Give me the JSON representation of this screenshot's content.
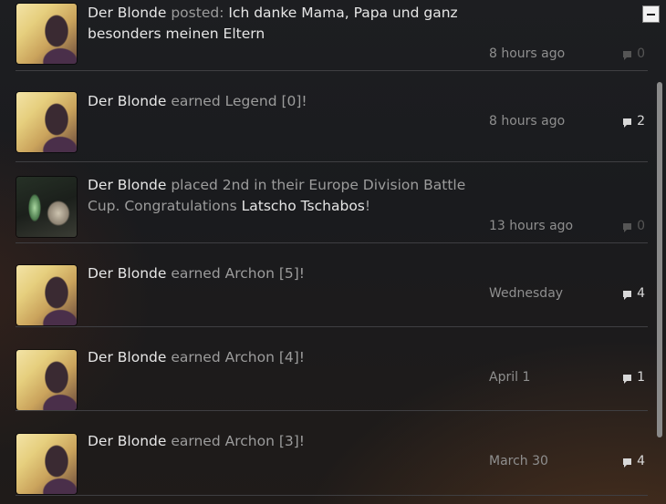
{
  "feed": {
    "items": [
      {
        "user": "Der Blonde",
        "action": "posted:",
        "text_rest": "Ich danke Mama, Papa und ganz besonders meinen Eltern",
        "time": "8 hours ago",
        "comments": "0"
      },
      {
        "user": "Der Blonde",
        "action": "earned Legend [0]!",
        "time": "8 hours ago",
        "comments": "2"
      },
      {
        "user": "Der Blonde",
        "action": "placed 2nd in their Europe Division Battle Cup.",
        "action2": "Congratulations",
        "team": "Latscho Tschabos",
        "exclaim": "!",
        "time": "13 hours ago",
        "comments": "0"
      },
      {
        "user": "Der Blonde",
        "action": "earned Archon [5]!",
        "time": "Wednesday",
        "comments": "4"
      },
      {
        "user": "Der Blonde",
        "action": "earned Archon [4]!",
        "time": "April 1",
        "comments": "1"
      },
      {
        "user": "Der Blonde",
        "action": "earned Archon [3]!",
        "time": "March 30",
        "comments": "4"
      }
    ]
  },
  "controls": {
    "collapse_icon": "minus-icon"
  },
  "colors": {
    "username": "#e6e6e6",
    "action_text": "#9c9c9c",
    "divider": "#3f3f42"
  }
}
